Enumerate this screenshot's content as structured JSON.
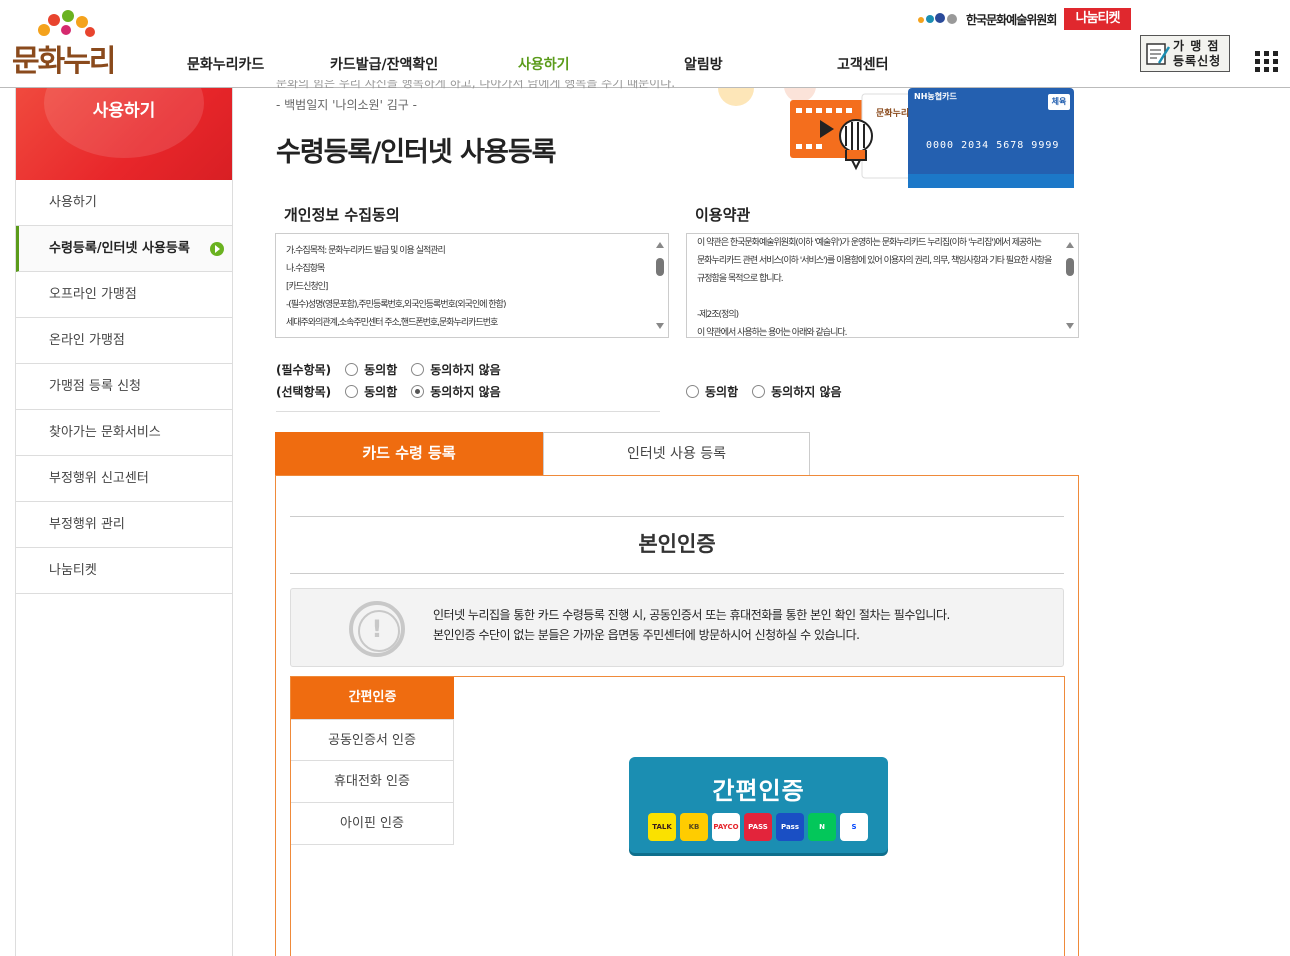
{
  "header": {
    "logo_text": "문화누리",
    "nav": [
      {
        "label": "문화누리카드",
        "active": false
      },
      {
        "label": "카드발급/잔액확인",
        "active": false
      },
      {
        "label": "사용하기",
        "active": true
      },
      {
        "label": "알림방",
        "active": false
      },
      {
        "label": "고객센터",
        "active": false
      }
    ],
    "arko_label": "한국문화예술위원회",
    "nanum_ticket": "나눔티켓",
    "merchant_btn": "가 맹 점 등록신청",
    "menu_icon": "grid-menu-icon"
  },
  "sidebar": {
    "title": "사용하기",
    "items": [
      {
        "label": "사용하기",
        "active": false
      },
      {
        "label": "수령등록/인터넷 사용등록",
        "active": true
      },
      {
        "label": "오프라인 가맹점",
        "active": false
      },
      {
        "label": "온라인 가맹점",
        "active": false
      },
      {
        "label": "가맹점 등록 신청",
        "active": false
      },
      {
        "label": "찾아가는 문화서비스",
        "active": false
      },
      {
        "label": "부정행위 신고센터",
        "active": false
      },
      {
        "label": "부정행위 관리",
        "active": false
      },
      {
        "label": "나눔티켓",
        "active": false
      }
    ]
  },
  "main": {
    "quote_partial": "문화의 힘은 우리 자신을 행복하게 하고, 나아가서 남에게 행복을 주기 때문이다.",
    "quote_author": "- 백범일지 '나의소원' 김구 -",
    "page_title": "수령등록/인터넷 사용등록",
    "hero": {
      "card_brand": "NH농협카드",
      "card_number": "0000 2034 5678 9999",
      "card_tag": "체육",
      "card_side_text": "문화누리"
    },
    "privacy": {
      "title": "개인정보 수집동의",
      "lines": [
        "가.수집목적: 문화누리카드 발급 및 이용 실적관리",
        "나.수집항목",
        "[카드신청인]",
        "-(필수)성명(영문포함),주민등록번호,외국인등록번호(외국인에 한함)",
        "세대주와의관계,소속주민센터 주소,핸드폰번호,문화누리카드번호"
      ],
      "required_label": "(필수항목)",
      "optional_label": "(선택항목)",
      "agree": "동의함",
      "disagree": "동의하지 않음"
    },
    "terms": {
      "title": "이용약관",
      "lines": [
        "이 약관은 한국문화예술위원회(이하 '예술위')가 운영하는 문화누리카드 누리집(이하 '누리집')에서 제공하는",
        "문화누리카드 관련 서비스(이하 '서비스')를 이용함에 있어 이용자의 권리, 의무, 책임사항과 기타 필요한 사항을",
        "규정함을 목적으로 합니다.",
        "",
        "-제2조(정의)",
        "이 약관에서 사용하는 용어는 아래와 같습니다."
      ],
      "agree": "동의함",
      "disagree": "동의하지 않음"
    },
    "tabs": [
      {
        "label": "카드 수령 등록",
        "active": true
      },
      {
        "label": "인터넷 사용 등록",
        "active": false
      }
    ],
    "auth": {
      "title": "본인인증",
      "notice_lines": [
        "인터넷 누리집을 통한 카드 수령등록 진행 시, 공동인증서 또는 휴대전화를 통한 본인 확인 절차는 필수입니다.",
        "본인인증 수단이 없는 분들은 가까운 읍면동 주민센터에 방문하시어 신청하실 수 있습니다."
      ],
      "menu": [
        {
          "label": "간편인증",
          "active": true
        },
        {
          "label": "공동인증서 인증",
          "active": false
        },
        {
          "label": "휴대전화 인증",
          "active": false
        },
        {
          "label": "아이핀 인증",
          "active": false
        }
      ],
      "simple_btn_title": "간편인증",
      "providers": [
        {
          "name": "TALK",
          "bg": "#fae100",
          "fg": "#3a1d1d"
        },
        {
          "name": "KB",
          "bg": "#ffcc00",
          "fg": "#5a4a1a"
        },
        {
          "name": "PAYCO",
          "bg": "#ffffff",
          "fg": "#e6242b"
        },
        {
          "name": "PASS",
          "bg": "#e3243b",
          "fg": "#ffffff"
        },
        {
          "name": "Pass",
          "bg": "#1a4fc4",
          "fg": "#ffffff"
        },
        {
          "name": "N",
          "bg": "#03c75a",
          "fg": "#ffffff"
        },
        {
          "name": "S",
          "bg": "#ffffff",
          "fg": "#0046ff"
        }
      ]
    }
  }
}
